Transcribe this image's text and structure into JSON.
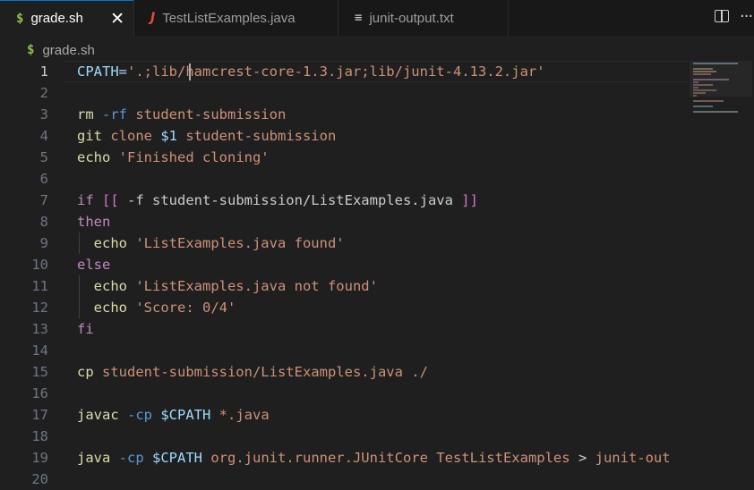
{
  "tabs": [
    {
      "label": "grade.sh",
      "icon": "$",
      "active": true
    },
    {
      "label": "TestListExamples.java",
      "icon": "J",
      "active": false
    },
    {
      "label": "junit-output.txt",
      "icon": "≡",
      "active": false
    }
  ],
  "tab_close_glyph": "✕",
  "breadcrumb": {
    "icon": "$",
    "file": "grade.sh"
  },
  "more_glyph": "···",
  "line_numbers": [
    "1",
    "2",
    "3",
    "4",
    "5",
    "6",
    "7",
    "8",
    "9",
    "10",
    "11",
    "12",
    "13",
    "14",
    "15",
    "16",
    "17",
    "18",
    "19",
    "20"
  ],
  "current_line": "1",
  "colors": {
    "accent": "#0078d4",
    "background": "#1f1f1f",
    "string": "#ce9178",
    "keyword": "#c586c0",
    "variable": "#9cdcfe"
  },
  "code": {
    "l1": {
      "a": "CPATH=",
      "b": "'.;lib/hamcrest-core-1.3.jar;lib/junit-4.13.2.jar'"
    },
    "l3": {
      "a": "rm ",
      "b": "-rf",
      "c": " student-submission"
    },
    "l4": {
      "a": "git ",
      "b": "clone ",
      "c": "$1",
      "d": " student-submission"
    },
    "l5": {
      "a": "echo ",
      "b": "'Finished cloning'"
    },
    "l7": {
      "a": "if ",
      "b": "[[",
      "c": " -f student-submission/ListExamples.java ",
      "d": "]]"
    },
    "l8": {
      "a": "then"
    },
    "l9": {
      "a": "  echo ",
      "b": "'ListExamples.java found'"
    },
    "l10": {
      "a": "else"
    },
    "l11": {
      "a": "  echo ",
      "b": "'ListExamples.java not found'"
    },
    "l12": {
      "a": "  echo ",
      "b": "'Score: 0/4'"
    },
    "l13": {
      "a": "fi"
    },
    "l15": {
      "a": "cp ",
      "b": "student-submission/ListExamples.java ./"
    },
    "l17": {
      "a": "javac ",
      "b": "-cp ",
      "c": "$CPATH",
      "d": " *.java"
    },
    "l19": {
      "a": "java ",
      "b": "-cp ",
      "c": "$CPATH",
      "d": " org.junit.runner.JUnitCore TestListExamples ",
      "e": ">",
      "f": " junit-out"
    }
  }
}
